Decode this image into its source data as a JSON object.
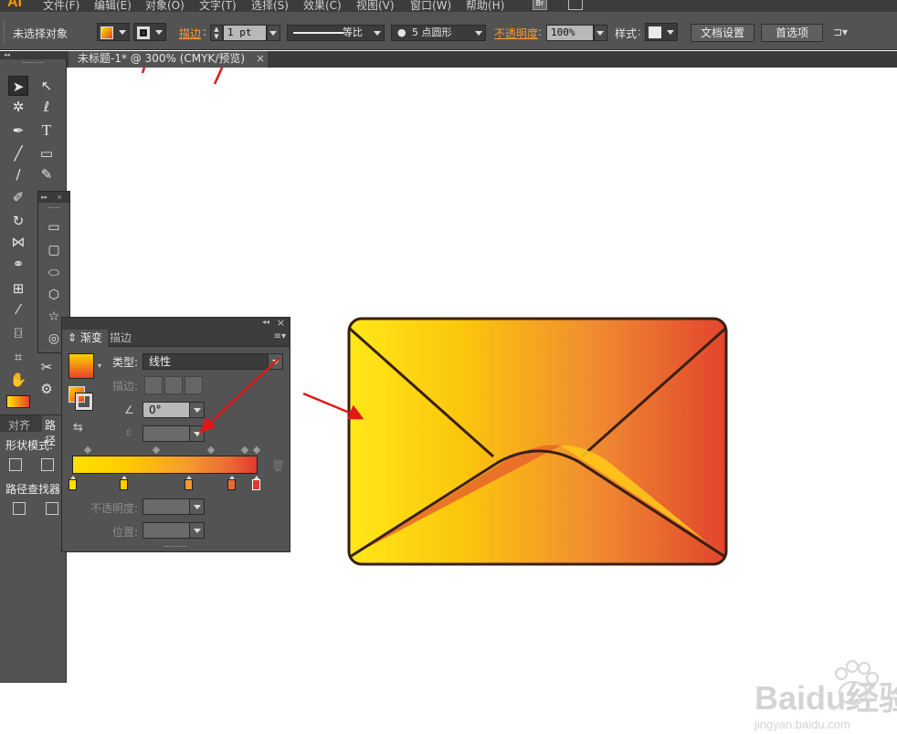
{
  "menubar": {
    "logo": "Ai",
    "items": [
      "文件(F)",
      "编辑(E)",
      "对象(O)",
      "文字(T)",
      "选择(S)",
      "效果(C)",
      "视图(V)",
      "窗口(W)",
      "帮助(H)"
    ],
    "bridge_label": "Br"
  },
  "controlbar": {
    "selection_status": "未选择对象",
    "stroke_label": "描边",
    "stroke_weight": "1 pt",
    "profile_label": "等比",
    "brush_label": "5 点圆形",
    "opacity_label": "不透明度",
    "opacity_value": "100%",
    "style_label": "样式",
    "doc_setup": "文档设置",
    "preferences": "首选项"
  },
  "document": {
    "tab_title": "未标题-1* @ 300% (CMYK/预览)",
    "close": "×"
  },
  "align_panel": {
    "tab_align": "对齐",
    "tab_pathfinder": "路径",
    "shape_modes": "形状模式:",
    "pathfinders": "路径查找器:"
  },
  "gradient_panel": {
    "tab_gradient": "渐变",
    "tab_stroke": "描边",
    "type_label": "类型:",
    "type_value": "线性",
    "stroke_label": "描边:",
    "angle_value": "0°",
    "opacity_label": "不透明度:",
    "location_label": "位置:",
    "stops": [
      "#ffe000",
      "#ffcc00",
      "#f49a2e",
      "#ea6a34",
      "#e03a2e"
    ]
  },
  "artwork": {
    "gradient_start": "#ffe818",
    "gradient_mid": "#fbc60c",
    "gradient_end": "#e2452e",
    "outline": "#3a1f12"
  },
  "watermark": {
    "brand": "Baidu经验",
    "url": "jingyan.baidu.com"
  }
}
